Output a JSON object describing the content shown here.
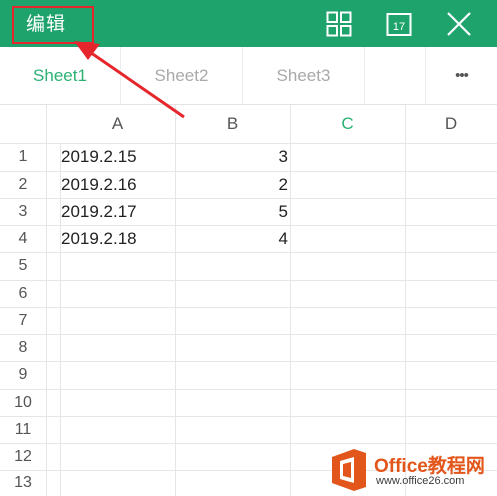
{
  "toolbar": {
    "edit_label": "编辑",
    "calendar_day": "17",
    "icons": [
      "grid-layout-icon",
      "calendar-icon",
      "close-icon"
    ],
    "bg_color": "#1fa36c",
    "highlight_color": "#e5262c"
  },
  "tabs": [
    {
      "label": "Sheet1",
      "active": true
    },
    {
      "label": "Sheet2",
      "active": false
    },
    {
      "label": "Sheet3",
      "active": false
    }
  ],
  "more_label": "•••",
  "columns": [
    "A",
    "B",
    "C",
    "D"
  ],
  "active_column": "C",
  "rows": [
    "1",
    "2",
    "3",
    "4",
    "5",
    "6",
    "7",
    "8",
    "9",
    "10",
    "11",
    "12",
    "13"
  ],
  "cells": {
    "A": [
      "2019.2.15",
      "2019.2.16",
      "2019.2.17",
      "2019.2.18"
    ],
    "B": [
      "3",
      "2",
      "5",
      "4"
    ]
  },
  "watermark": {
    "brand": "Office教程网",
    "url": "www.office26.com",
    "accent": "#e2561b"
  }
}
